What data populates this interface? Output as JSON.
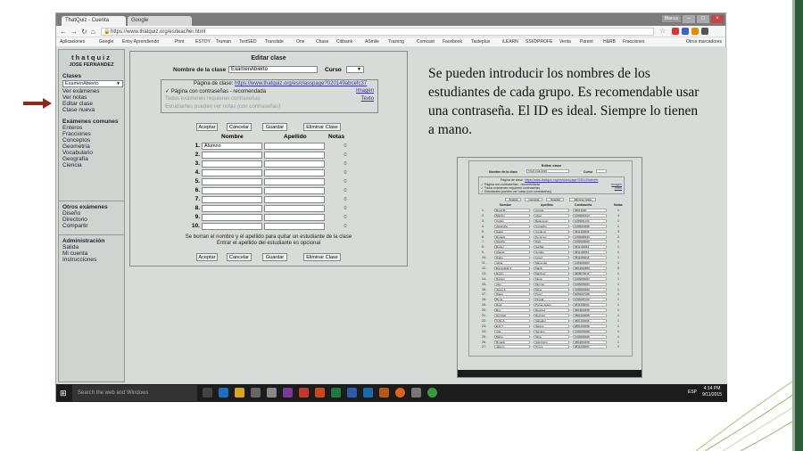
{
  "browser": {
    "tabs": [
      {
        "label": "ThatQuiz - Cuenta"
      },
      {
        "label": "Google"
      }
    ],
    "user_badge": "Blanca",
    "url": "https://www.thatquiz.org/es/teacher.html",
    "bookmarks": [
      "Aplicaciones",
      "Google",
      "Entry Aprendiendo",
      "Print",
      "ESTOY",
      "Truman",
      "TestSED",
      "Translate",
      "One",
      "Chase",
      "Citibank",
      "ASmile",
      "Training",
      "Comcast",
      "Facebook",
      "Tasteplus",
      "iLEARN",
      "SSI/DPROFE",
      "Venta",
      "Parent",
      "H&RB",
      "Fracciones",
      "Otros marcadores"
    ]
  },
  "sidebar": {
    "brand": "thatquiz",
    "username": "JOSE FERNANDEZ",
    "classes_heading": "Clases",
    "selected_class": "ExamenAbierto",
    "class_links": [
      "Ver exámenes",
      "Ver notas",
      "Editar clase",
      "Clase nueva"
    ],
    "common_heading": "Exámenes comunes",
    "common_links": [
      "Enteros",
      "Fracciones",
      "Conceptos",
      "Geometría",
      "Vocabulario",
      "Geografía",
      "Ciencia"
    ],
    "other_heading": "Otros exámenes",
    "other_links": [
      "Diseño",
      "Directorio",
      "Compartir"
    ],
    "admin_heading": "Administración",
    "admin_links": [
      "Salida",
      "Mi cuenta",
      "Instrucciones"
    ]
  },
  "form": {
    "title": "Editar clase",
    "name_label": "Nombre de la clase",
    "name_value": "ExamenAbierto",
    "curso_label": "Curso",
    "page_label": "Página de clase:",
    "page_url": "https://www.thatquiz.org/es/classpage?020149abcefc37",
    "opt_password": "Página con contraseñas - recomendada",
    "opt_image": "Imagen",
    "opt_exams": "Todos exámenes requieren contraseñas",
    "opt_text": "Texto",
    "opt_notes": "Estudiantes pueden ver notas (con contraseñas)",
    "btn_accept": "Aceptar",
    "btn_cancel": "Cancelar",
    "btn_save": "Guardar",
    "btn_delete": "Eliminar Clase",
    "col_name": "Nombre",
    "col_surname": "Apellido",
    "col_notes": "Notas",
    "rows": [
      {
        "num": "1.",
        "name": "Alumno",
        "surname": "",
        "nota": "0"
      },
      {
        "num": "2.",
        "name": "",
        "surname": "",
        "nota": "0"
      },
      {
        "num": "3.",
        "name": "",
        "surname": "",
        "nota": "0"
      },
      {
        "num": "4.",
        "name": "",
        "surname": "",
        "nota": "0"
      },
      {
        "num": "5.",
        "name": "",
        "surname": "",
        "nota": "0"
      },
      {
        "num": "6.",
        "name": "",
        "surname": "",
        "nota": "0"
      },
      {
        "num": "7.",
        "name": "",
        "surname": "",
        "nota": "0"
      },
      {
        "num": "8.",
        "name": "",
        "surname": "",
        "nota": "0"
      },
      {
        "num": "9.",
        "name": "",
        "surname": "",
        "nota": "0"
      },
      {
        "num": "10.",
        "name": "",
        "surname": "",
        "nota": "0"
      }
    ],
    "note_line1": "Se borran el nombre y el apellido para quitar un estudiante de la clase",
    "note_line2": "Entrar el apellido del estudiante es opcional"
  },
  "taskbar": {
    "search_placeholder": "Search the web and Windows",
    "lang": "ESP",
    "time": "4:14 PM",
    "date": "9/11/2015"
  },
  "description": "Se pueden introducir los nombres de los estudiantes de cada grupo. Es recomendable usar una contraseña. El ID es ideal. Siempre lo tienen a mano.",
  "thumb": {
    "title": "Editar clase",
    "name_label": "Nombre de la clase",
    "name_value": "TALK-Fall-2015",
    "curso_label": "Curso",
    "page_label": "Página de clase:",
    "page_url": "https://www.thatquiz.org/es/classpage?020149abcefc",
    "opt_password": "Página con contraseñas - recomendada",
    "opt_exams": "Todos exámenes requieren contraseñas",
    "opt_notes": "Estudiantes pueden ver notas (con contraseñas)",
    "opt_image": "Imagen",
    "opt_text": "Texto",
    "btn_accept": "Aceptar",
    "btn_cancel": "Cancelar",
    "btn_save": "Guardar",
    "btn_delete": "Eliminar Clase",
    "col_name": "Nombre",
    "col_surname": "Apellido",
    "col_password": "Contraseña",
    "col_notes": "Notas",
    "rows": [
      {
        "num": "1.",
        "name": "Rosa M.",
        "surname": "Acosta",
        "pw": "08014000",
        "nota": "1"
      },
      {
        "num": "2.",
        "name": "Marilyn",
        "surname": "Alvar",
        "pw": "1066001520",
        "nota": "4"
      },
      {
        "num": "3.",
        "name": "Carlos",
        "surname": "Betancourt",
        "pw": "1066001100",
        "nota": "1"
      },
      {
        "num": "4.",
        "name": "Alejandra",
        "surname": "Camacho",
        "pw": "1066004068",
        "nota": "1"
      },
      {
        "num": "5.",
        "name": "Isabel",
        "surname": "Cardona",
        "pw": "0811400006",
        "nota": "3"
      },
      {
        "num": "6.",
        "name": "Rosario",
        "surname": "De la Luz",
        "pw": "1066086930",
        "nota": "2"
      },
      {
        "num": "7.",
        "name": "Sandra",
        "surname": "Diaz",
        "pw": "1066000060",
        "nota": "1"
      },
      {
        "num": "8.",
        "name": "Daniel",
        "surname": "Garfias",
        "pw": "0811100061",
        "nota": "1"
      },
      {
        "num": "9.",
        "name": "Claude",
        "surname": "Gordon",
        "pw": "0811100061",
        "nota": "1"
      },
      {
        "num": "10.",
        "name": "Diane",
        "surname": "Lopez",
        "pw": "0811080016",
        "nota": "1"
      },
      {
        "num": "11.",
        "name": "Alicia",
        "surname": "Maysonet",
        "pw": "1066006600",
        "nota": "1"
      },
      {
        "num": "12.",
        "name": "Esmeralda V.",
        "surname": "Martin",
        "pw": "0804092880",
        "nota": "0"
      },
      {
        "num": "13.",
        "name": "Nancy",
        "surname": "Martinez",
        "pw": "0808070011",
        "nota": "1"
      },
      {
        "num": "14.",
        "name": "Ramon",
        "surname": "Mena",
        "pw": "1066006090",
        "nota": "1"
      },
      {
        "num": "15.",
        "name": "Alex",
        "surname": "Monroe",
        "pw": "1066006090",
        "nota": "1"
      },
      {
        "num": "16.",
        "name": "Jesus A.",
        "surname": "Mora",
        "pw": "1066006680",
        "nota": "1"
      },
      {
        "num": "17.",
        "name": "Diana",
        "surname": "Perez",
        "pw": "0066007008",
        "nota": "1"
      },
      {
        "num": "18.",
        "name": "Rene",
        "surname": "Pineda",
        "pw": "1066001000",
        "nota": "1"
      },
      {
        "num": "19.",
        "name": "Raul",
        "surname": "Porras-Isiken",
        "pw": "0811066000",
        "nota": "1"
      },
      {
        "num": "20.",
        "name": "Ruy",
        "surname": "Ramirez",
        "pw": "0804000458",
        "nota": "1"
      },
      {
        "num": "21.",
        "name": "Gonzalo",
        "surname": "Recinos",
        "pw": "0801000008",
        "nota": "1"
      },
      {
        "num": "22.",
        "name": "Cirilo A.",
        "surname": "Salvador",
        "pw": "0801100068",
        "nota": "1"
      },
      {
        "num": "23.",
        "name": "Erin Y.",
        "surname": "Santos",
        "pw": "0801000058",
        "nota": "1"
      },
      {
        "num": "24.",
        "name": "Lilia",
        "surname": "Serrano",
        "pw": "1066066008",
        "nota": "1"
      },
      {
        "num": "25.",
        "name": "Maria",
        "surname": "Silva",
        "pw": "1066006689",
        "nota": "1"
      },
      {
        "num": "26.",
        "name": "Rogelio",
        "surname": "Solorzano",
        "pw": "0804000408",
        "nota": "1"
      },
      {
        "num": "27.",
        "name": "Jasmin",
        "surname": "Torres",
        "pw": "0811000050",
        "nota": "1"
      }
    ]
  }
}
